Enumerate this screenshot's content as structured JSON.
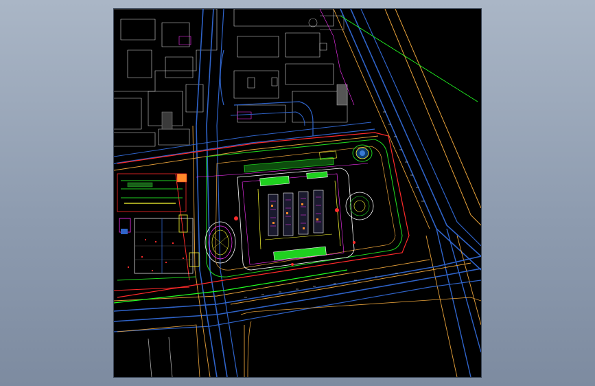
{
  "window": {
    "background_color": "#9aa7b8",
    "canvas_color": "#000000"
  },
  "drawing": {
    "type": "cad-site-plan",
    "layer_colors": {
      "road_centerline": "#2f63c8",
      "road_edge": "#e8a23a",
      "site_boundary": "#ff2a2a",
      "green_zone": "#1fd11f",
      "building_outline": "#ffffff",
      "annotation": "#ffffff",
      "survey_line": "#2aff2a",
      "landscape": "#ffff33",
      "utility": "#ff33ff"
    },
    "labels": {
      "east_road": "",
      "south_road": "",
      "west_road": ""
    }
  }
}
